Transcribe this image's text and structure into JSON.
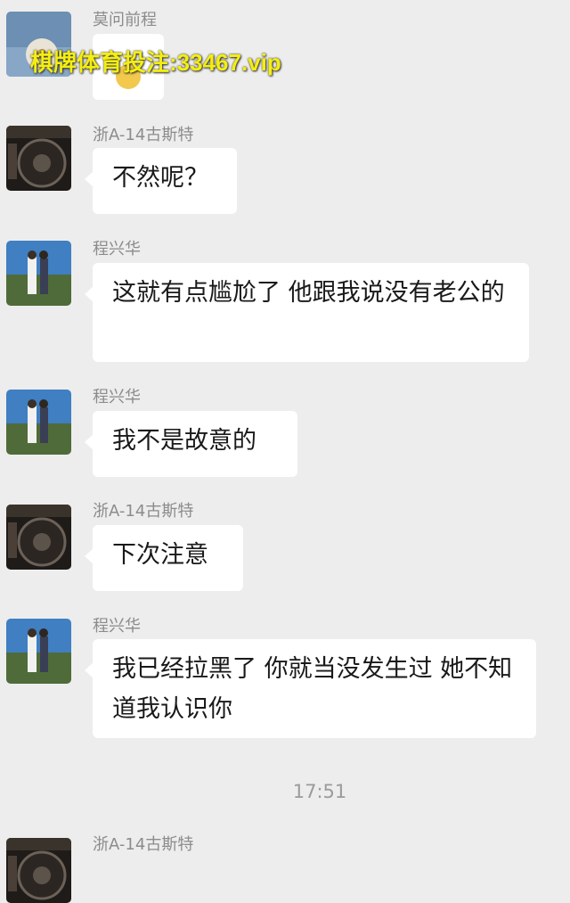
{
  "watermark": "棋牌体育投注:33467.vip",
  "messages": [
    {
      "sender": "莫问前程",
      "text": "",
      "avatar_icon": "flower-avatar"
    },
    {
      "sender": "浙A-14古斯特",
      "text": "不然呢？",
      "avatar_icon": "car-wheel-avatar"
    },
    {
      "sender": "程兴华",
      "text": "这就有点尴尬了 他跟我说没有老公的",
      "avatar_icon": "couple-photo-avatar"
    },
    {
      "sender": "程兴华",
      "text": "我不是故意的",
      "avatar_icon": "couple-photo-avatar"
    },
    {
      "sender": "浙A-14古斯特",
      "text": "下次注意",
      "avatar_icon": "car-wheel-avatar"
    },
    {
      "sender": "程兴华",
      "text": "我已经拉黑了 你就当没发生过 她不知道我认识你",
      "avatar_icon": "couple-photo-avatar"
    },
    {
      "sender": "浙A-14古斯特",
      "text": "",
      "avatar_icon": "car-wheel-avatar"
    }
  ],
  "timestamp": "17:51",
  "colors": {
    "background": "#ededed",
    "bubble": "#ffffff",
    "watermark": "#f4ee10"
  }
}
